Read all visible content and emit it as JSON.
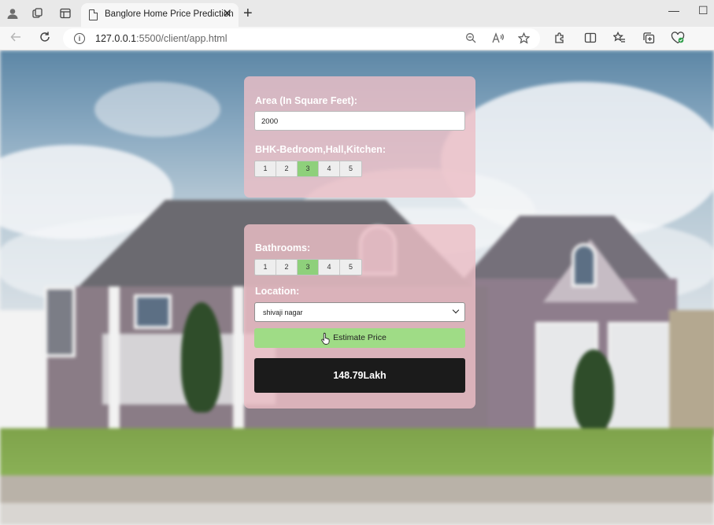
{
  "browser": {
    "tab_title": "Banglore Home Price Prediction",
    "tab_close": "✕",
    "new_tab": "+",
    "url_host": "127.0.0.1",
    "url_path": ":5500/client/app.html",
    "minimize": "—",
    "maximize": "☐"
  },
  "form": {
    "area_label": "Area (In Square Feet):",
    "area_value": "2000",
    "bhk_label": "BHK-Bedroom,Hall,Kitchen:",
    "bhk_options": [
      "1",
      "2",
      "3",
      "4",
      "5"
    ],
    "bhk_selected": "3",
    "bath_label": "Bathrooms:",
    "bath_options": [
      "1",
      "2",
      "3",
      "4",
      "5"
    ],
    "bath_selected": "3",
    "location_label": "Location:",
    "location_value": "shivaji nagar",
    "estimate_label": "Estimate Price",
    "result": "148.79Lakh"
  },
  "colors": {
    "panel_bg": "#ecbec6",
    "selected_option": "#8ed07b",
    "estimate_button": "#9fdc86",
    "result_bg": "#1b1b1b"
  },
  "icons": [
    "profile-icon",
    "workspaces-icon",
    "tab-actions-icon",
    "page-icon",
    "back-icon",
    "refresh-icon",
    "site-info-icon",
    "zoom-icon",
    "read-aloud-icon",
    "favorite-star-icon",
    "extensions-icon",
    "split-screen-icon",
    "favorites-icon",
    "collections-icon",
    "browser-essentials-icon"
  ]
}
